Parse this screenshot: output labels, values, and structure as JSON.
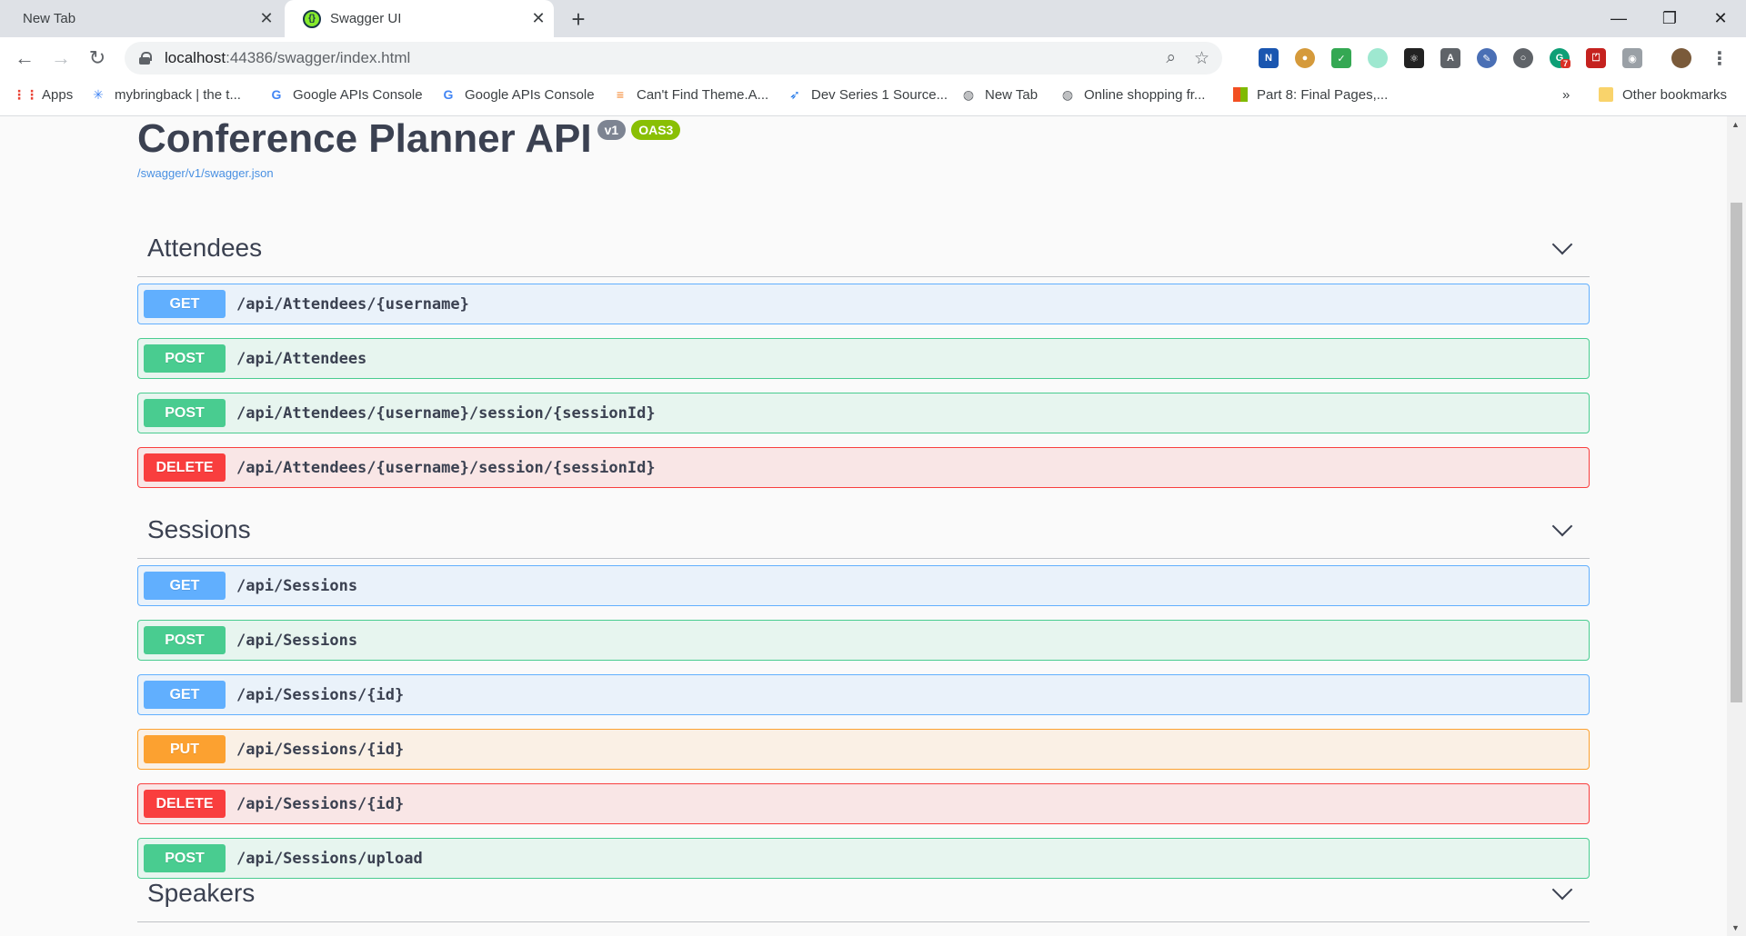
{
  "browser": {
    "tabs": [
      {
        "title": "New Tab",
        "active": false
      },
      {
        "title": "Swagger UI",
        "active": true
      }
    ],
    "url_host": "localhost",
    "url_rest": ":44386/swagger/index.html",
    "ext_badge_count": "7",
    "bookmarks": [
      {
        "label": "Apps",
        "icon": "apps-grid-icon"
      },
      {
        "label": "mybringback | the t...",
        "icon": "star-burst-icon"
      },
      {
        "label": "Google APIs Console",
        "icon": "google-icon"
      },
      {
        "label": "Google APIs Console",
        "icon": "google-icon"
      },
      {
        "label": "Can't Find Theme.A...",
        "icon": "stackoverflow-icon"
      },
      {
        "label": "Dev Series 1 Source...",
        "icon": "rocket-icon"
      },
      {
        "label": "New Tab",
        "icon": "globe-icon"
      },
      {
        "label": "Online shopping fr...",
        "icon": "globe-icon"
      },
      {
        "label": "Part 8: Final Pages,...",
        "icon": "microsoft-icon"
      }
    ],
    "other_bookmarks": "Other bookmarks",
    "overflow": "»"
  },
  "page": {
    "title": "Conference Planner API",
    "version_badge": "v1",
    "oas_badge": "OAS3",
    "spec_link": "/swagger/v1/swagger.json",
    "sections": [
      {
        "name": "Attendees",
        "operations": [
          {
            "method": "GET",
            "path": "/api/Attendees/{username}"
          },
          {
            "method": "POST",
            "path": "/api/Attendees"
          },
          {
            "method": "POST",
            "path": "/api/Attendees/{username}/session/{sessionId}"
          },
          {
            "method": "DELETE",
            "path": "/api/Attendees/{username}/session/{sessionId}"
          }
        ]
      },
      {
        "name": "Sessions",
        "operations": [
          {
            "method": "GET",
            "path": "/api/Sessions"
          },
          {
            "method": "POST",
            "path": "/api/Sessions"
          },
          {
            "method": "GET",
            "path": "/api/Sessions/{id}"
          },
          {
            "method": "PUT",
            "path": "/api/Sessions/{id}"
          },
          {
            "method": "DELETE",
            "path": "/api/Sessions/{id}"
          },
          {
            "method": "POST",
            "path": "/api/Sessions/upload"
          }
        ]
      },
      {
        "name": "Speakers",
        "operations": []
      }
    ]
  },
  "colors": {
    "get": "#61affe",
    "post": "#49cc90",
    "delete": "#f93e3e",
    "put": "#fca130"
  }
}
